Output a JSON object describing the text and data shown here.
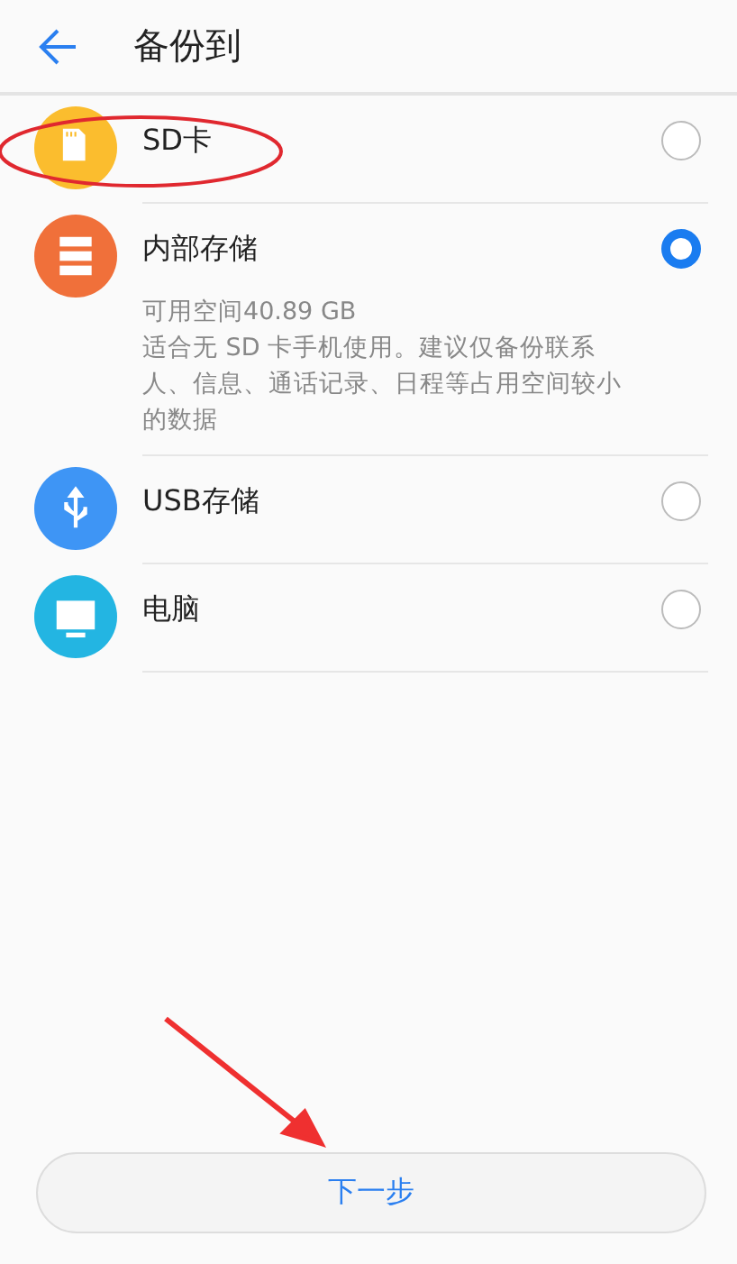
{
  "header": {
    "title": "备份到"
  },
  "options": [
    {
      "kind": "sd",
      "color": "#fbbd2e",
      "label": "SD卡",
      "selected": false,
      "circled": true
    },
    {
      "kind": "storage",
      "color": "#f0703a",
      "label": "内部存储",
      "selected": true,
      "details": [
        "可用空间40.89 GB",
        "适合无 SD 卡手机使用。建议仅备份联系人、信息、通话记录、日程等占用空间较小的数据"
      ]
    },
    {
      "kind": "usb",
      "color": "#3e95f5",
      "label": "USB存储",
      "selected": false
    },
    {
      "kind": "pc",
      "color": "#23b5e2",
      "label": "电脑",
      "selected": false
    }
  ],
  "next_button": {
    "label": "下一步",
    "arrow_pointing": true
  }
}
